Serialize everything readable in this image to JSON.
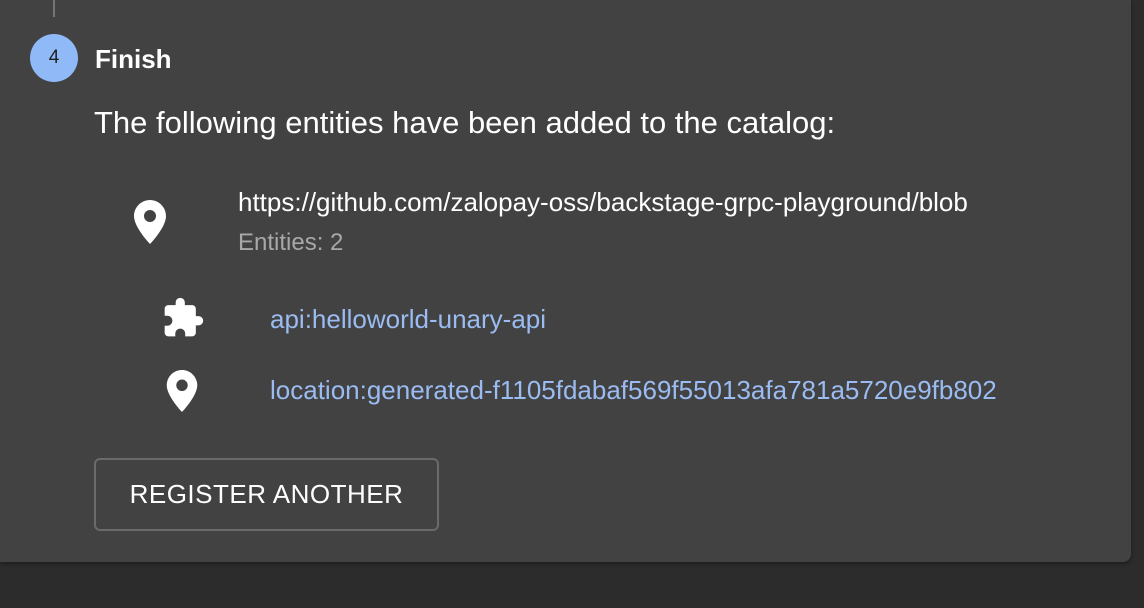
{
  "step": {
    "number": "4",
    "label": "Finish"
  },
  "intro_text": "The following entities have been added to the catalog:",
  "location": {
    "url": "https://github.com/zalopay-oss/backstage-grpc-playground/blob",
    "count_text": "Entities: 2",
    "icon": "location-pin-icon"
  },
  "entities": [
    {
      "text": "api:helloworld-unary-api",
      "icon": "puzzle-piece-icon"
    },
    {
      "text": "location:generated-f1105fdabaf569f55013afa781a5720e9fb802",
      "icon": "location-pin-icon"
    }
  ],
  "actions": {
    "register_another_label": "REGISTER ANOTHER"
  },
  "colors": {
    "background": "#2c2c2c",
    "card": "#424242",
    "step_circle": "#90b9f7",
    "link": "#9bbcf2",
    "secondary_text": "#a8a8a8"
  }
}
